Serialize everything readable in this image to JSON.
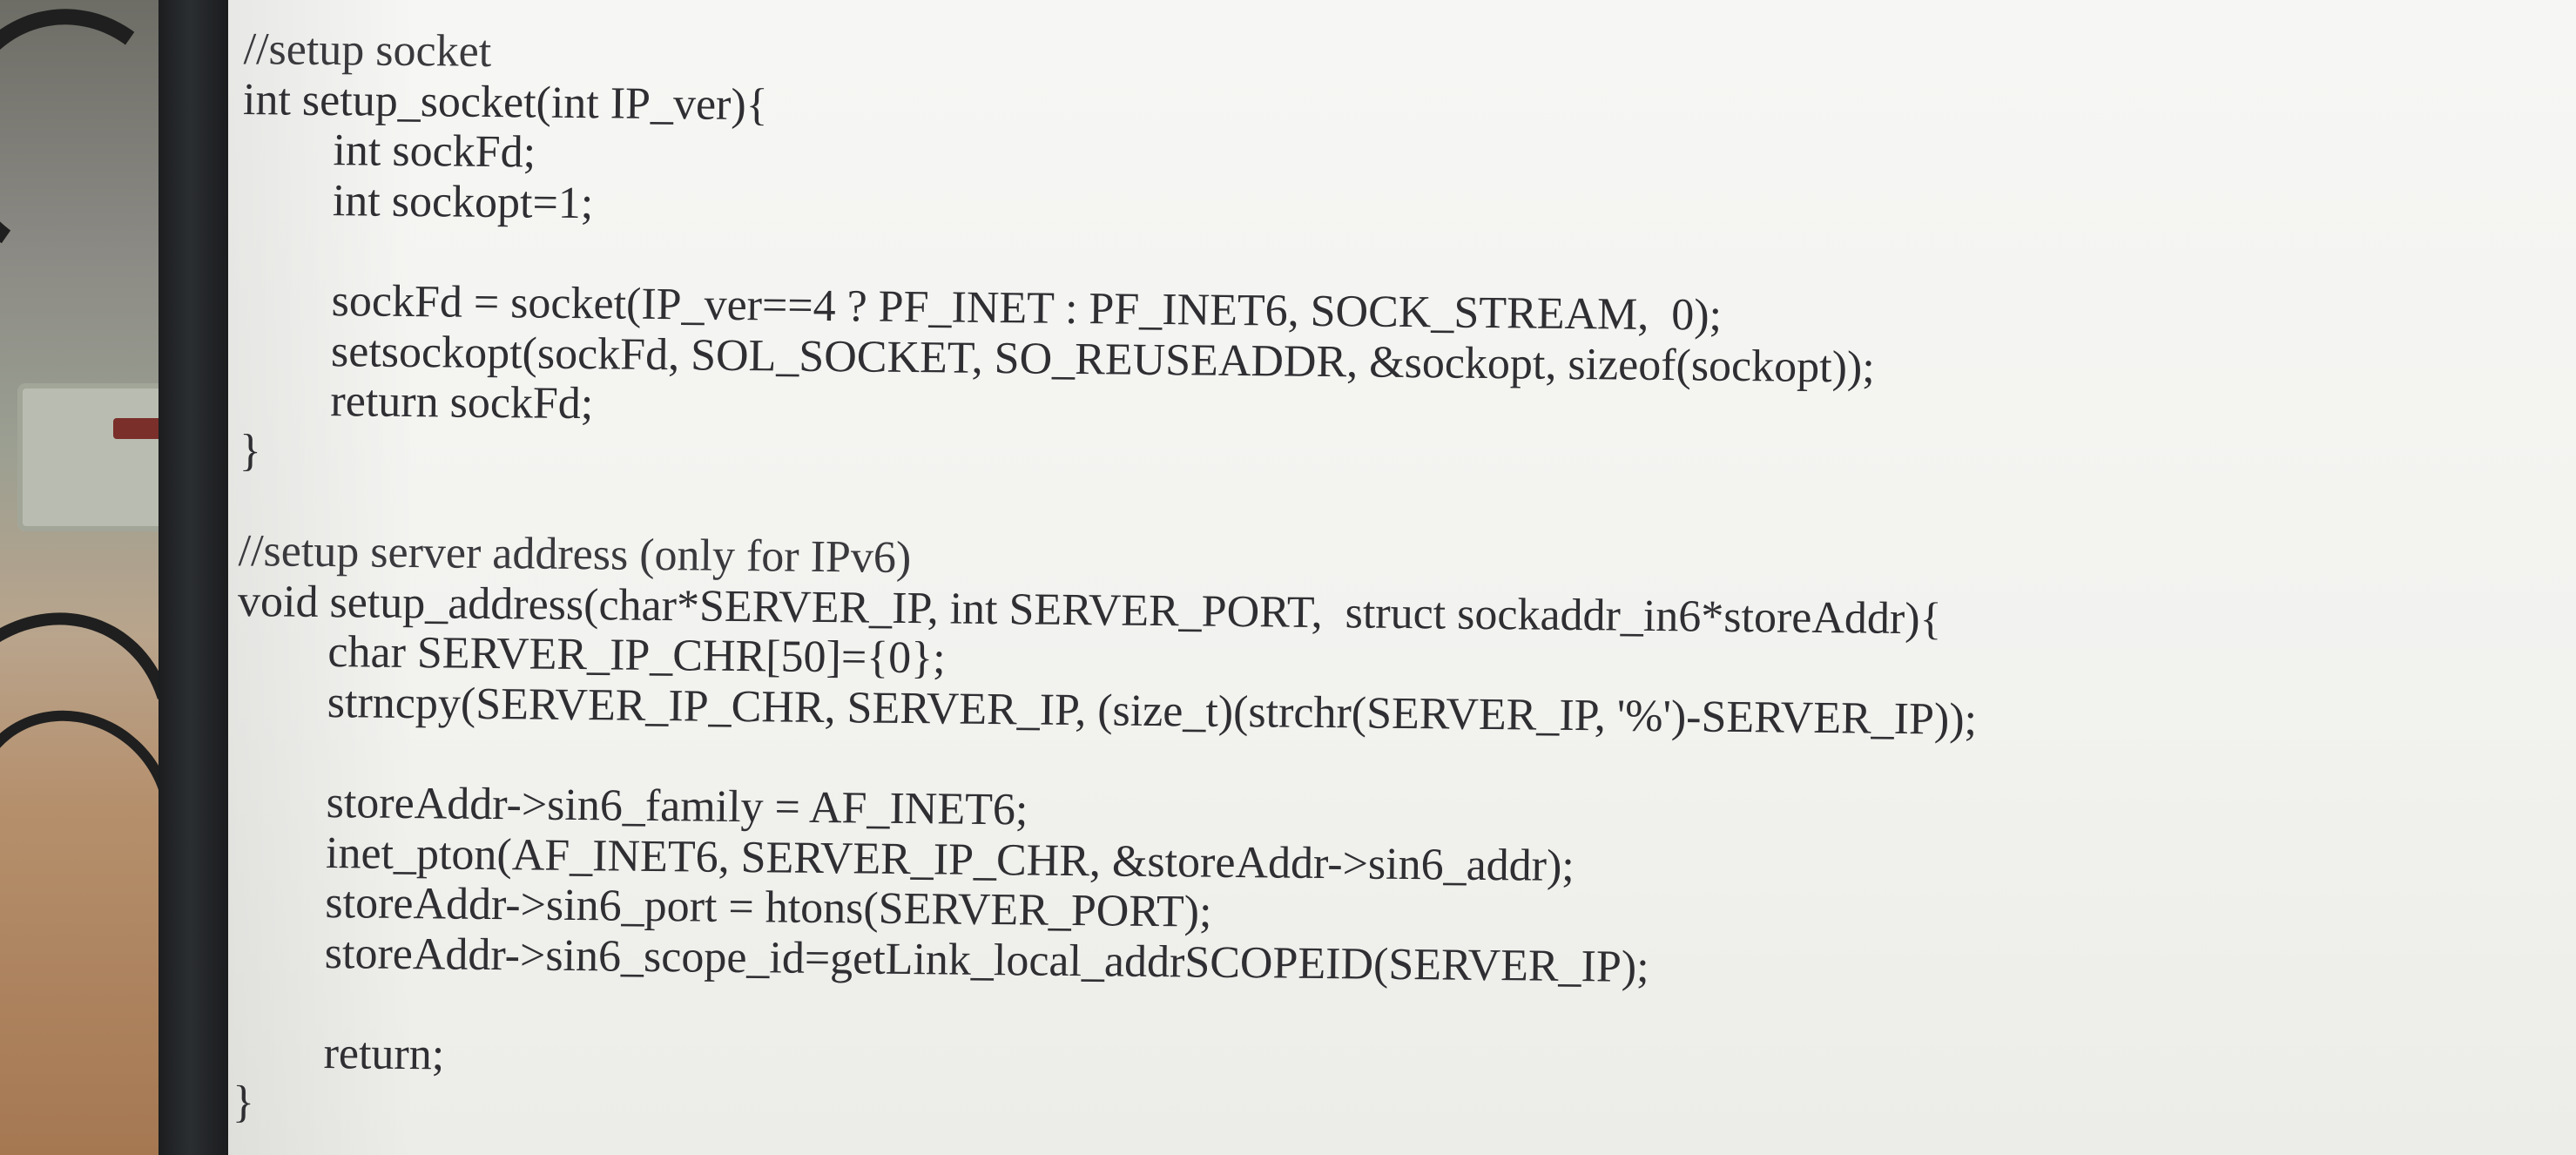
{
  "code_lines": [
    "//setup socket",
    "int setup_socket(int IP_ver){",
    "        int sockFd;",
    "        int sockopt=1;",
    "",
    "        sockFd = socket(IP_ver==4 ? PF_INET : PF_INET6, SOCK_STREAM,  0);",
    "        setsockopt(sockFd, SOL_SOCKET, SO_REUSEADDR, &sockopt, sizeof(sockopt));",
    "        return sockFd;",
    "}",
    "",
    "//setup server address (only for IPv6)",
    "void setup_address(char*SERVER_IP, int SERVER_PORT,  struct sockaddr_in6*storeAddr){",
    "        char SERVER_IP_CHR[50]={0};",
    "        strncpy(SERVER_IP_CHR, SERVER_IP, (size_t)(strchr(SERVER_IP, '%')-SERVER_IP));",
    "",
    "        storeAddr->sin6_family = AF_INET6;",
    "        inet_pton(AF_INET6, SERVER_IP_CHR, &storeAddr->sin6_addr);",
    "        storeAddr->sin6_port = htons(SERVER_PORT);",
    "        storeAddr->sin6_scope_id=getLink_local_addrSCOPEID(SERVER_IP);",
    "",
    "        return;",
    "}"
  ],
  "colors": {
    "code_text": "#2f2f33",
    "screen_background": "#f4f4f1",
    "bezel": "#1f2124"
  }
}
